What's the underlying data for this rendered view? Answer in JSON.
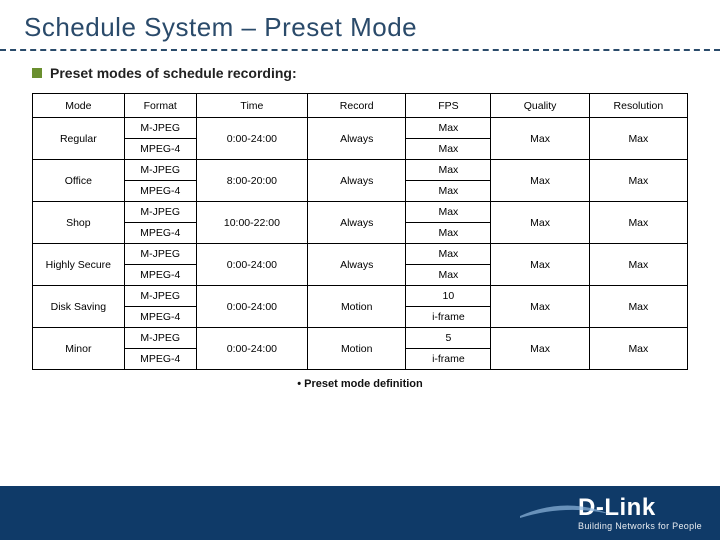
{
  "title": "Schedule System – Preset Mode",
  "subtitle": "Preset modes of schedule recording:",
  "table": {
    "headers": [
      "Mode",
      "Format",
      "Time",
      "Record",
      "FPS",
      "Quality",
      "Resolution"
    ],
    "modes": [
      {
        "name": "Regular",
        "formats": [
          "M-JPEG",
          "MPEG-4"
        ],
        "time": "0:00-24:00",
        "record": "Always",
        "fps": [
          "Max",
          "Max"
        ],
        "quality": "Max",
        "resolution": "Max"
      },
      {
        "name": "Office",
        "formats": [
          "M-JPEG",
          "MPEG-4"
        ],
        "time": "8:00-20:00",
        "record": "Always",
        "fps": [
          "Max",
          "Max"
        ],
        "quality": "Max",
        "resolution": "Max"
      },
      {
        "name": "Shop",
        "formats": [
          "M-JPEG",
          "MPEG-4"
        ],
        "time": "10:00-22:00",
        "record": "Always",
        "fps": [
          "Max",
          "Max"
        ],
        "quality": "Max",
        "resolution": "Max"
      },
      {
        "name": "Highly Secure",
        "formats": [
          "M-JPEG",
          "MPEG-4"
        ],
        "time": "0:00-24:00",
        "record": "Always",
        "fps": [
          "Max",
          "Max"
        ],
        "quality": "Max",
        "resolution": "Max"
      },
      {
        "name": "Disk Saving",
        "formats": [
          "M-JPEG",
          "MPEG-4"
        ],
        "time": "0:00-24:00",
        "record": "Motion",
        "fps": [
          "10",
          "i-frame"
        ],
        "quality": "Max",
        "resolution": "Max"
      },
      {
        "name": "Minor",
        "formats": [
          "M-JPEG",
          "MPEG-4"
        ],
        "time": "0:00-24:00",
        "record": "Motion",
        "fps": [
          "5",
          "i-frame"
        ],
        "quality": "Max",
        "resolution": "Max"
      }
    ]
  },
  "caption": "• Preset mode definition",
  "brand": {
    "name": "D-Link",
    "tagline": "Building Networks for People"
  }
}
